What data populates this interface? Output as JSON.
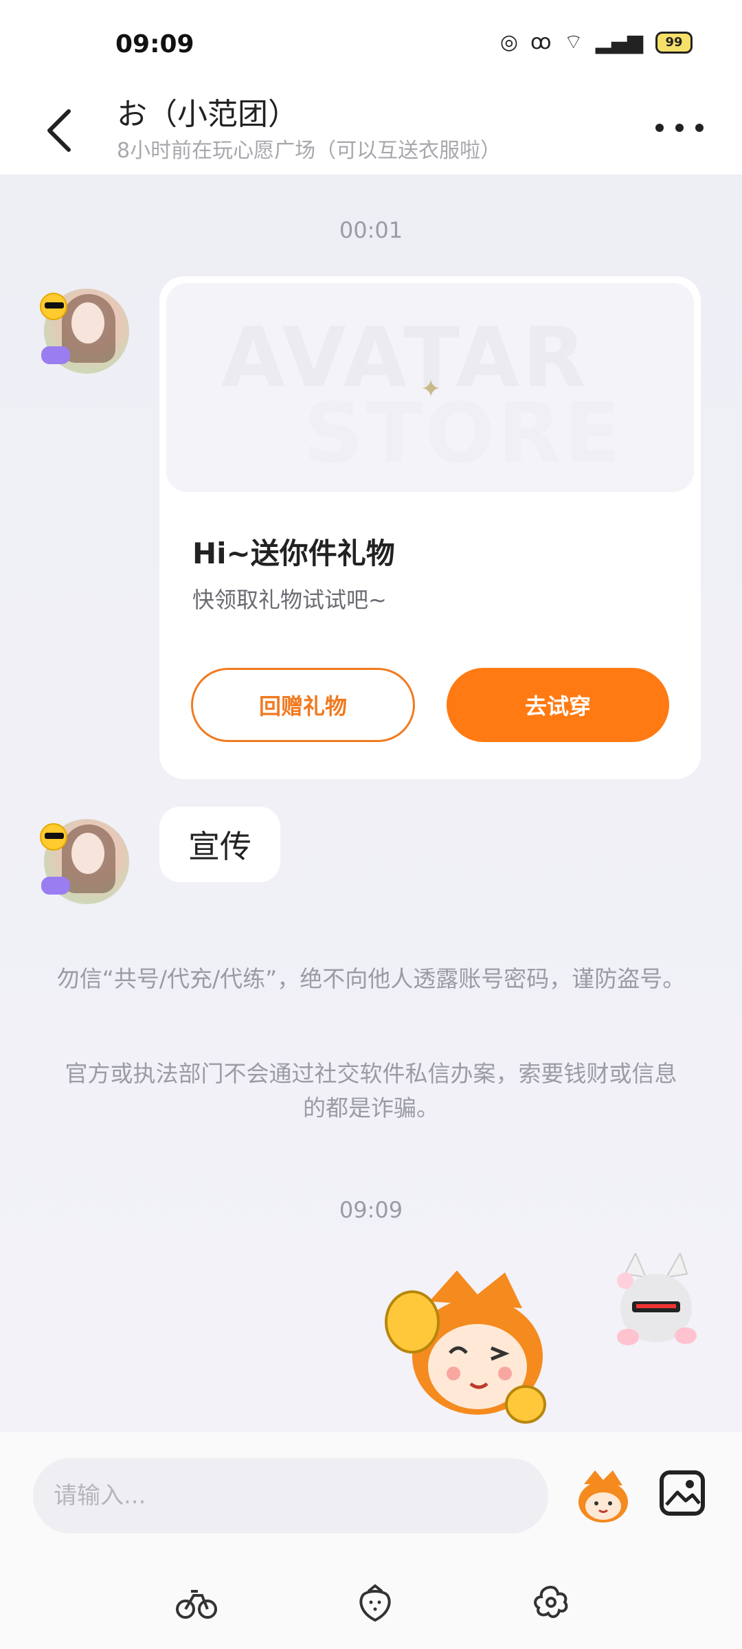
{
  "status_bar": {
    "time": "09:09",
    "battery": "99"
  },
  "header": {
    "title": "お（小范团）",
    "subtitle": "8小时前在玩心愿广场（可以互送衣服啦）"
  },
  "messages": {
    "timestamp_1": "00:01",
    "gift_card": {
      "banner_line_1": "AVATAR",
      "banner_line_2": "STORE",
      "title": "Hi~送你件礼物",
      "description": "快领取礼物试试吧~",
      "return_gift_label": "回赠礼物",
      "try_on_label": "去试穿"
    },
    "text_message": "宣传",
    "notice_1": "勿信“共号/代充/代练”，绝不向他人透露账号密码，谨防盗号。",
    "notice_2": "官方或执法部门不会通过社交软件私信办案，索要钱财或信息的都是诈骗。",
    "timestamp_2": "09:09"
  },
  "input_bar": {
    "placeholder": "请输入..."
  },
  "colors": {
    "accent": "#ff7a12",
    "background": "#f2f2f7"
  }
}
